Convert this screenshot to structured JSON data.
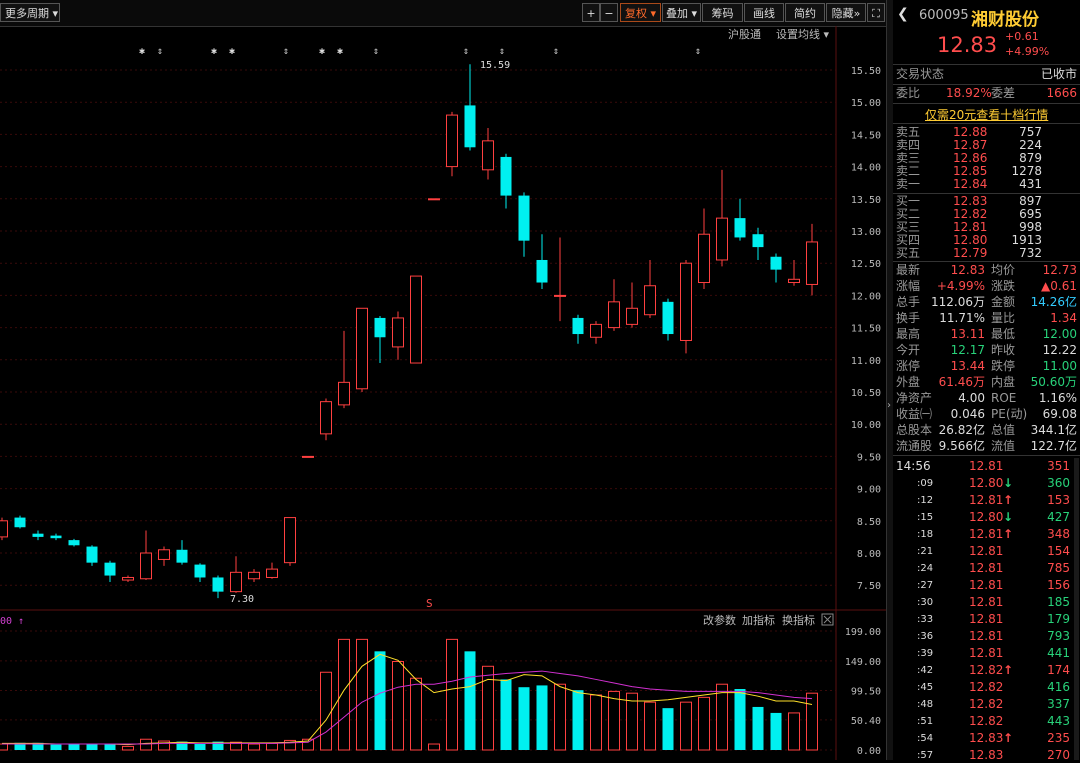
{
  "toolbar": {
    "period": "更多周期",
    "buttons": [
      "复权",
      "叠加",
      "筹码",
      "画线",
      "简约",
      "隐藏"
    ],
    "sub_links": [
      "沪股通",
      "设置均线"
    ]
  },
  "price_axis": [
    "15.50",
    "15.00",
    "14.50",
    "14.00",
    "13.50",
    "13.00",
    "12.50",
    "12.00",
    "11.50",
    "11.00",
    "10.50",
    "10.00",
    "9.50",
    "9.00",
    "8.50",
    "8.00",
    "7.50"
  ],
  "annotations": {
    "high_label": "15.59",
    "low_label": "7.30",
    "s_marker": "S"
  },
  "volume_panel": {
    "left_label": "00 ↑",
    "links": [
      "改参数",
      "加指标",
      "换指标"
    ],
    "axis": [
      "199.00",
      "149.00",
      "99.50",
      "50.40",
      "0.00"
    ]
  },
  "stock": {
    "code": "600095",
    "name": "湘财股份",
    "price": "12.83",
    "change": "+0.61",
    "change_pct": "+4.99%"
  },
  "status": {
    "label": "交易状态",
    "value": "已收市"
  },
  "weibi": {
    "label": "委比",
    "value": "18.92%",
    "diff_label": "委差",
    "diff_value": "1666"
  },
  "promo": "仅需20元查看十档行情",
  "sell_orders": [
    {
      "label": "卖五",
      "price": "12.88",
      "vol": "757"
    },
    {
      "label": "卖四",
      "price": "12.87",
      "vol": "224"
    },
    {
      "label": "卖三",
      "price": "12.86",
      "vol": "879"
    },
    {
      "label": "卖二",
      "price": "12.85",
      "vol": "1278"
    },
    {
      "label": "卖一",
      "price": "12.84",
      "vol": "431"
    }
  ],
  "buy_orders": [
    {
      "label": "买一",
      "price": "12.83",
      "vol": "897"
    },
    {
      "label": "买二",
      "price": "12.82",
      "vol": "695"
    },
    {
      "label": "买三",
      "price": "12.81",
      "vol": "998"
    },
    {
      "label": "买四",
      "price": "12.80",
      "vol": "1913"
    },
    {
      "label": "买五",
      "price": "12.79",
      "vol": "732"
    }
  ],
  "quote": [
    {
      "l1": "最新",
      "v1": "12.83",
      "c1": "red",
      "l2": "均价",
      "v2": "12.73",
      "c2": "red"
    },
    {
      "l1": "涨幅",
      "v1": "+4.99%",
      "c1": "red",
      "l2": "涨跌",
      "v2": "▲0.61",
      "c2": "red"
    },
    {
      "l1": "总手",
      "v1": "112.06万",
      "c1": "white",
      "l2": "金额",
      "v2": "14.26亿",
      "c2": "cyan"
    },
    {
      "l1": "换手",
      "v1": "11.71%",
      "c1": "white",
      "l2": "量比",
      "v2": "1.34",
      "c2": "red"
    },
    {
      "l1": "最高",
      "v1": "13.11",
      "c1": "red",
      "l2": "最低",
      "v2": "12.00",
      "c2": "green"
    },
    {
      "l1": "今开",
      "v1": "12.17",
      "c1": "green",
      "l2": "昨收",
      "v2": "12.22",
      "c2": "white"
    },
    {
      "l1": "涨停",
      "v1": "13.44",
      "c1": "red",
      "l2": "跌停",
      "v2": "11.00",
      "c2": "green"
    },
    {
      "l1": "外盘",
      "v1": "61.46万",
      "c1": "red",
      "l2": "内盘",
      "v2": "50.60万",
      "c2": "green"
    },
    {
      "l1": "净资产",
      "v1": "4.00",
      "c1": "white",
      "l2": "ROE",
      "v2": "1.16%",
      "c2": "white"
    },
    {
      "l1": "收益㈠",
      "v1": "0.046",
      "c1": "white",
      "l2": "PE(动)",
      "v2": "69.08",
      "c2": "white"
    },
    {
      "l1": "总股本",
      "v1": "26.82亿",
      "c1": "white",
      "l2": "总值",
      "v2": "344.1亿",
      "c2": "white"
    },
    {
      "l1": "流通股",
      "v1": "9.566亿",
      "c1": "white",
      "l2": "流值",
      "v2": "122.7亿",
      "c2": "white"
    }
  ],
  "ticks": [
    {
      "t": "14:56",
      "p": "12.81",
      "a": "",
      "v": "351",
      "c": "red"
    },
    {
      "t": ":09",
      "p": "12.80",
      "a": "↓",
      "v": "360",
      "c": "green"
    },
    {
      "t": ":12",
      "p": "12.81",
      "a": "↑",
      "v": "153",
      "c": "red"
    },
    {
      "t": ":15",
      "p": "12.80",
      "a": "↓",
      "v": "427",
      "c": "green"
    },
    {
      "t": ":18",
      "p": "12.81",
      "a": "↑",
      "v": "348",
      "c": "red"
    },
    {
      "t": ":21",
      "p": "12.81",
      "a": "",
      "v": "154",
      "c": "red"
    },
    {
      "t": ":24",
      "p": "12.81",
      "a": "",
      "v": "785",
      "c": "red"
    },
    {
      "t": ":27",
      "p": "12.81",
      "a": "",
      "v": "156",
      "c": "red"
    },
    {
      "t": ":30",
      "p": "12.81",
      "a": "",
      "v": "185",
      "c": "green"
    },
    {
      "t": ":33",
      "p": "12.81",
      "a": "",
      "v": "179",
      "c": "green"
    },
    {
      "t": ":36",
      "p": "12.81",
      "a": "",
      "v": "793",
      "c": "green"
    },
    {
      "t": ":39",
      "p": "12.81",
      "a": "",
      "v": "441",
      "c": "green"
    },
    {
      "t": ":42",
      "p": "12.82",
      "a": "↑",
      "v": "174",
      "c": "red"
    },
    {
      "t": ":45",
      "p": "12.82",
      "a": "",
      "v": "416",
      "c": "green"
    },
    {
      "t": ":48",
      "p": "12.82",
      "a": "",
      "v": "337",
      "c": "green"
    },
    {
      "t": ":51",
      "p": "12.82",
      "a": "",
      "v": "443",
      "c": "green"
    },
    {
      "t": ":54",
      "p": "12.83",
      "a": "↑",
      "v": "235",
      "c": "red"
    },
    {
      "t": ":57",
      "p": "12.83",
      "a": "",
      "v": "270",
      "c": "red"
    }
  ],
  "candles": [
    {
      "o": 8.25,
      "c": 8.5,
      "h": 8.55,
      "l": 8.2
    },
    {
      "o": 8.55,
      "c": 8.4,
      "h": 8.58,
      "l": 8.38
    },
    {
      "o": 8.3,
      "c": 8.25,
      "h": 8.35,
      "l": 8.2
    },
    {
      "o": 8.27,
      "c": 8.23,
      "h": 8.3,
      "l": 8.2
    },
    {
      "o": 8.2,
      "c": 8.12,
      "h": 8.22,
      "l": 8.1
    },
    {
      "o": 8.1,
      "c": 7.85,
      "h": 8.12,
      "l": 7.8
    },
    {
      "o": 7.85,
      "c": 7.65,
      "h": 7.88,
      "l": 7.55
    },
    {
      "o": 7.58,
      "c": 7.62,
      "h": 7.65,
      "l": 7.55
    },
    {
      "o": 7.6,
      "c": 8.0,
      "h": 8.35,
      "l": 7.58
    },
    {
      "o": 7.9,
      "c": 8.05,
      "h": 8.1,
      "l": 7.8
    },
    {
      "o": 8.05,
      "c": 7.85,
      "h": 8.2,
      "l": 7.82
    },
    {
      "o": 7.82,
      "c": 7.62,
      "h": 7.84,
      "l": 7.55
    },
    {
      "o": 7.62,
      "c": 7.4,
      "h": 7.65,
      "l": 7.3
    },
    {
      "o": 7.4,
      "c": 7.7,
      "h": 7.95,
      "l": 7.38
    },
    {
      "o": 7.6,
      "c": 7.7,
      "h": 7.75,
      "l": 7.55
    },
    {
      "o": 7.62,
      "c": 7.75,
      "h": 7.85,
      "l": 7.6
    },
    {
      "o": 7.85,
      "c": 8.55,
      "h": 8.55,
      "l": 7.8
    },
    {
      "o": 9.5,
      "c": 9.5,
      "h": 9.5,
      "l": 9.5
    },
    {
      "o": 9.85,
      "c": 10.35,
      "h": 10.4,
      "l": 9.75
    },
    {
      "o": 10.3,
      "c": 10.65,
      "h": 11.45,
      "l": 10.25
    },
    {
      "o": 10.55,
      "c": 11.8,
      "h": 11.8,
      "l": 10.5
    },
    {
      "o": 11.65,
      "c": 11.35,
      "h": 11.68,
      "l": 10.95
    },
    {
      "o": 11.2,
      "c": 11.65,
      "h": 11.75,
      "l": 11.0
    },
    {
      "o": 10.95,
      "c": 12.3,
      "h": 12.3,
      "l": 10.95
    },
    {
      "o": 13.5,
      "c": 13.5,
      "h": 13.5,
      "l": 13.5
    },
    {
      "o": 14.0,
      "c": 14.8,
      "h": 14.85,
      "l": 13.85
    },
    {
      "o": 14.95,
      "c": 14.3,
      "h": 15.59,
      "l": 14.25
    },
    {
      "o": 13.95,
      "c": 14.4,
      "h": 14.6,
      "l": 13.8
    },
    {
      "o": 14.15,
      "c": 13.55,
      "h": 14.2,
      "l": 13.35
    },
    {
      "o": 13.55,
      "c": 12.85,
      "h": 13.6,
      "l": 12.6
    },
    {
      "o": 12.55,
      "c": 12.2,
      "h": 12.95,
      "l": 12.1
    },
    {
      "o": 12.0,
      "c": 12.0,
      "h": 12.9,
      "l": 11.6
    },
    {
      "o": 11.65,
      "c": 11.4,
      "h": 11.7,
      "l": 11.25
    },
    {
      "o": 11.35,
      "c": 11.55,
      "h": 11.6,
      "l": 11.25
    },
    {
      "o": 11.5,
      "c": 11.9,
      "h": 12.25,
      "l": 11.45
    },
    {
      "o": 11.55,
      "c": 11.8,
      "h": 12.2,
      "l": 11.5
    },
    {
      "o": 11.7,
      "c": 12.15,
      "h": 12.55,
      "l": 11.65
    },
    {
      "o": 11.9,
      "c": 11.4,
      "h": 11.95,
      "l": 11.3
    },
    {
      "o": 11.3,
      "c": 12.5,
      "h": 12.55,
      "l": 11.1
    },
    {
      "o": 12.2,
      "c": 12.95,
      "h": 13.35,
      "l": 12.1
    },
    {
      "o": 12.55,
      "c": 13.2,
      "h": 13.95,
      "l": 12.45
    },
    {
      "o": 13.2,
      "c": 12.9,
      "h": 13.5,
      "l": 12.85
    },
    {
      "o": 12.95,
      "c": 12.75,
      "h": 13.05,
      "l": 12.55
    },
    {
      "o": 12.6,
      "c": 12.4,
      "h": 12.65,
      "l": 12.2
    },
    {
      "o": 12.2,
      "c": 12.25,
      "h": 12.55,
      "l": 12.15
    },
    {
      "o": 12.17,
      "c": 12.83,
      "h": 13.11,
      "l": 12.0
    }
  ],
  "volumes": [
    10,
    12,
    12,
    9,
    10,
    10,
    10,
    6,
    18,
    15,
    14,
    10,
    14,
    13,
    10,
    11,
    16,
    18,
    130,
    185,
    185,
    165,
    148,
    120,
    10,
    185,
    165,
    140,
    118,
    105,
    108,
    110,
    100,
    92,
    98,
    95,
    80,
    70,
    80,
    88,
    110,
    102,
    72,
    62,
    62,
    95
  ],
  "ma_short": [
    11,
    11,
    11,
    10,
    10,
    10,
    10,
    9,
    11,
    12,
    13,
    12,
    12,
    12,
    12,
    12,
    13,
    15,
    50,
    100,
    140,
    160,
    150,
    118,
    96,
    102,
    106,
    118,
    116,
    126,
    124,
    106,
    96,
    92,
    86,
    82,
    82,
    84,
    88,
    92,
    96,
    96,
    90,
    82,
    82,
    76
  ],
  "ma_long": [
    10,
    10,
    10,
    10,
    10,
    10,
    10,
    10,
    10,
    11,
    11,
    11,
    11,
    11,
    11,
    11,
    12,
    13,
    30,
    55,
    80,
    95,
    105,
    110,
    110,
    115,
    122,
    125,
    128,
    130,
    132,
    128,
    124,
    118,
    112,
    106,
    102,
    100,
    98,
    98,
    98,
    98,
    96,
    92,
    88,
    86
  ]
}
